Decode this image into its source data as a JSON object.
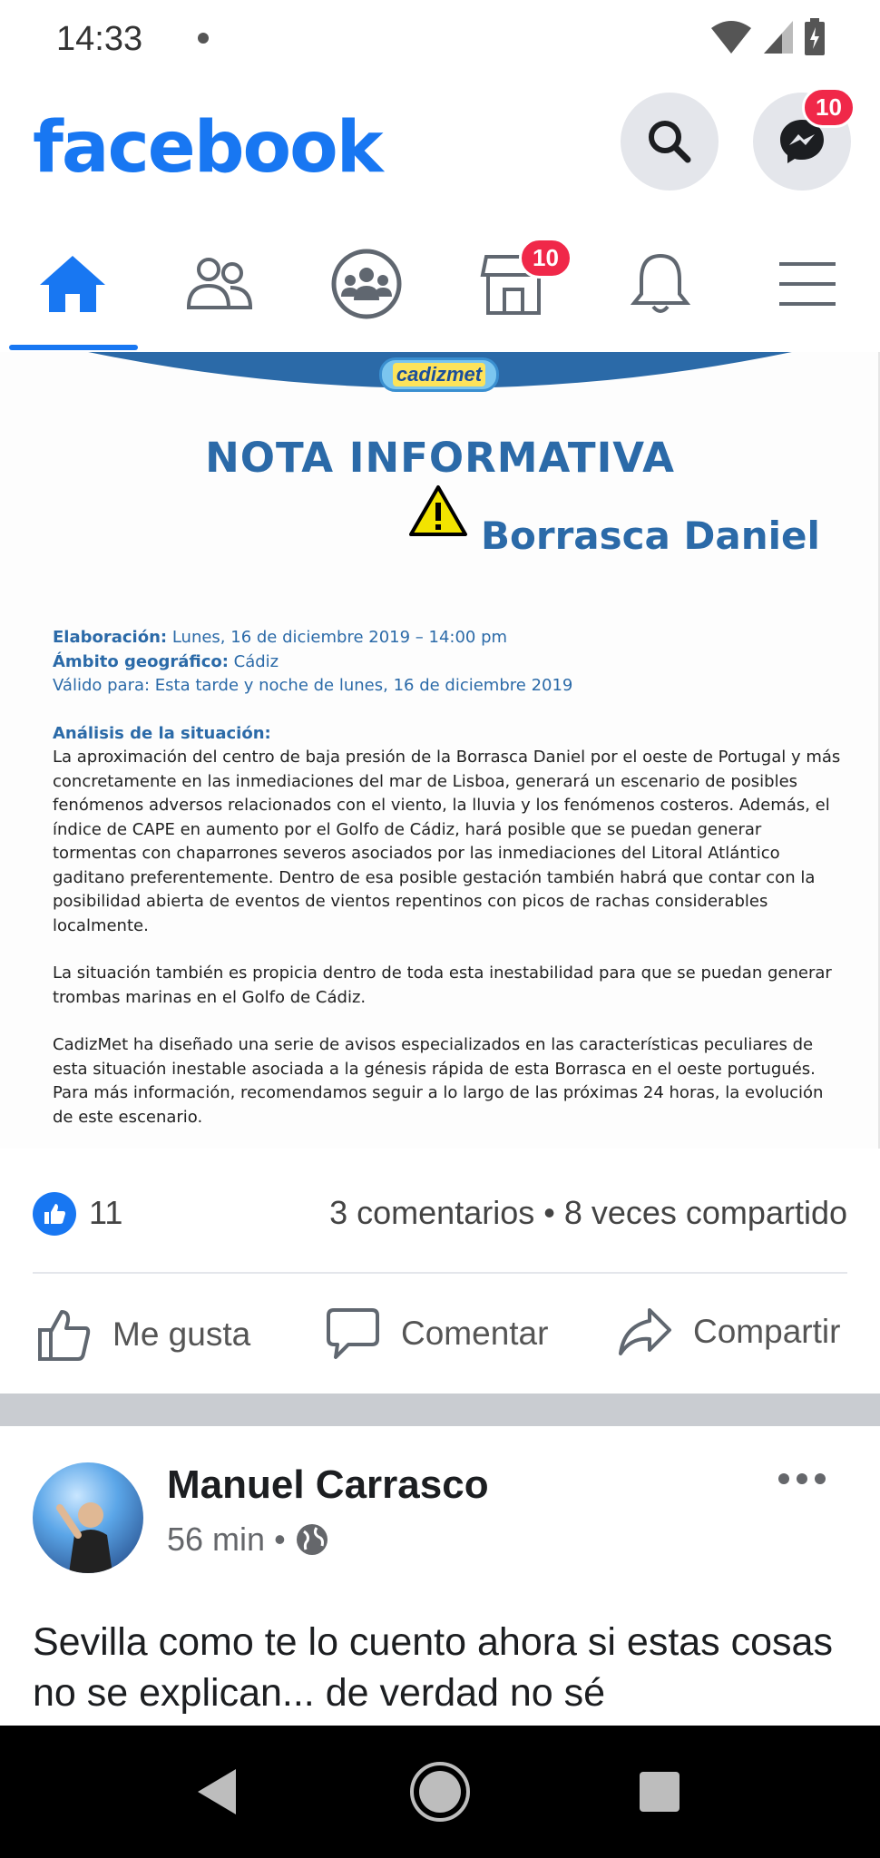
{
  "status_bar": {
    "time": "14:33"
  },
  "app": {
    "logo": "facebook",
    "search_icon": "search-icon",
    "messenger_badge": "10"
  },
  "tabs": [
    {
      "name": "home",
      "active": true
    },
    {
      "name": "friends"
    },
    {
      "name": "groups"
    },
    {
      "name": "marketplace",
      "badge": "10"
    },
    {
      "name": "notifications"
    },
    {
      "name": "menu"
    }
  ],
  "post_image": {
    "logo_text": "cadizmet",
    "title": "NOTA INFORMATIVA",
    "subtitle": "Borrasca Daniel",
    "elaboracion_label": "Elaboración:",
    "elaboracion_value": " Lunes, 16 de diciembre 2019 – 14:00 pm",
    "ambito_label": "Ámbito geográfico:",
    "ambito_value": " Cádiz",
    "valido": "Válido para: Esta tarde y noche de lunes, 16 de diciembre 2019",
    "analisis_label": "Análisis de la situación:",
    "paragraph1": "La aproximación del centro de baja presión de la Borrasca Daniel por el oeste de Portugal y más concretamente en las inmediaciones del mar de Lisboa, generará un escenario de posibles fenómenos adversos relacionados con el viento, la lluvia y los fenómenos costeros. Además, el índice de CAPE en aumento por el Golfo de Cádiz, hará posible que se puedan generar tormentas con chaparrones severos asociados por las inmediaciones del Litoral Atlántico gaditano preferentemente. Dentro de esa posible gestación también habrá que contar con la posibilidad abierta de eventos de vientos repentinos con picos de rachas considerables localmente.",
    "paragraph2": "La situación también es propicia dentro de toda esta inestabilidad para que se puedan generar trombas marinas en el Golfo de Cádiz.",
    "paragraph3": "CadizMet ha diseñado una serie de avisos especializados en las características peculiares de esta situación inestable asociada a la génesis rápida de esta Borrasca en el oeste portugués. Para más información, recomendamos seguir a lo largo de las próximas 24 horas, la evolución de este escenario."
  },
  "reactions": {
    "like_count": "11",
    "counts": "3 comentarios • 8 veces compartido"
  },
  "actions": {
    "like": "Me gusta",
    "comment": "Comentar",
    "share": "Compartir"
  },
  "next_post": {
    "author": "Manuel Carrasco",
    "time": "56 min",
    "separator": "•",
    "text": "Sevilla como te lo cuento ahora si estas cosas no se explican... de verdad no sé"
  },
  "colors": {
    "brand": "#1877f2",
    "badge": "#f02849",
    "doc_blue": "#2b6aa8"
  }
}
